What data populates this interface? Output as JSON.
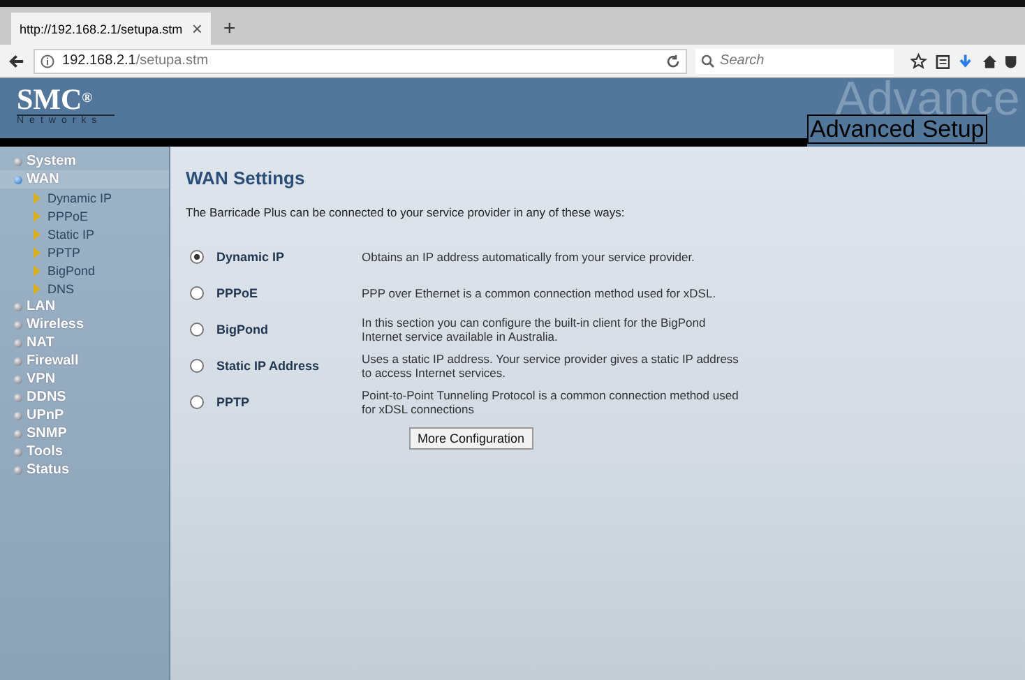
{
  "browser": {
    "tab_title": "http://192.168.2.1/setupa.stm",
    "tab_close": "×",
    "new_tab": "+",
    "url_host": "192.168.2.1",
    "url_path": "/setupa.stm",
    "search_placeholder": "Search"
  },
  "header": {
    "logo": "SMC",
    "registered": "®",
    "tagline": "Networks",
    "watermark": "Advance",
    "title": "Advanced Setup"
  },
  "sidebar": {
    "items": [
      {
        "label": "System",
        "selected": false
      },
      {
        "label": "WAN",
        "selected": true,
        "children": [
          {
            "label": "Dynamic IP"
          },
          {
            "label": "PPPoE"
          },
          {
            "label": "Static IP"
          },
          {
            "label": "PPTP"
          },
          {
            "label": "BigPond"
          },
          {
            "label": "DNS"
          }
        ]
      },
      {
        "label": "LAN",
        "selected": false
      },
      {
        "label": "Wireless",
        "selected": false
      },
      {
        "label": "NAT",
        "selected": false
      },
      {
        "label": "Firewall",
        "selected": false
      },
      {
        "label": "VPN",
        "selected": false
      },
      {
        "label": "DDNS",
        "selected": false
      },
      {
        "label": "UPnP",
        "selected": false
      },
      {
        "label": "SNMP",
        "selected": false
      },
      {
        "label": "Tools",
        "selected": false
      },
      {
        "label": "Status",
        "selected": false
      }
    ]
  },
  "content": {
    "heading": "WAN Settings",
    "intro": "The Barricade Plus can be connected to your service provider in any of these ways:",
    "options": [
      {
        "label": "Dynamic IP",
        "description": "Obtains an IP address automatically from your service provider.",
        "selected": true
      },
      {
        "label": "PPPoE",
        "description": "PPP over Ethernet is a common connection method used for xDSL.",
        "selected": false
      },
      {
        "label": "BigPond",
        "description": "In this section you can configure the built-in client for the BigPond Internet service available in Australia.",
        "selected": false
      },
      {
        "label": "Static IP Address",
        "description": "Uses a static IP address. Your service provider gives a static IP address to access Internet services.",
        "selected": false
      },
      {
        "label": "PPTP",
        "description": "Point-to-Point Tunneling Protocol is a common connection method used for xDSL connections",
        "selected": false
      }
    ],
    "button": "More Configuration"
  }
}
